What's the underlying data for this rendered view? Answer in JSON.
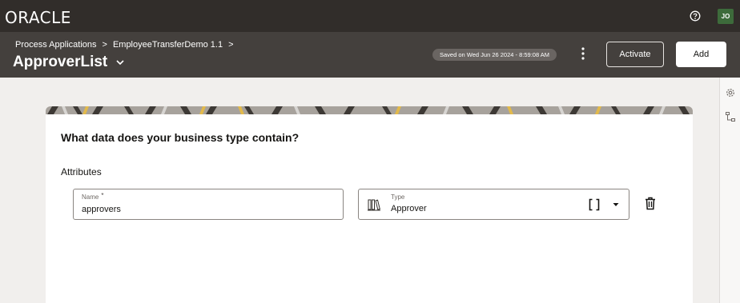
{
  "topbar": {
    "logo": "ORACLE",
    "help_icon": "help-circle-icon",
    "avatar_initials": "JO"
  },
  "header": {
    "breadcrumb": [
      "Process Applications",
      "EmployeeTransferDemo 1.1"
    ],
    "breadcrumb_separator": ">",
    "title": "ApproverList",
    "saved_status": "Saved on Wed Jun 26 2024 - 8:59:08 AM",
    "activate_label": "Activate",
    "add_label": "Add"
  },
  "form": {
    "heading": "What data does your business type contain?",
    "attributes_label": "Attributes",
    "attribute": {
      "name_label": "Name",
      "required_marker": "*",
      "name_value": "approvers",
      "type_label": "Type",
      "type_value": "Approver",
      "list_indicator": "[]"
    }
  },
  "colors": {
    "topbar_bg": "#312d2a",
    "header_bg": "#44403d",
    "page_bg": "#f1efed",
    "avatar_bg": "#3d6b3b"
  }
}
